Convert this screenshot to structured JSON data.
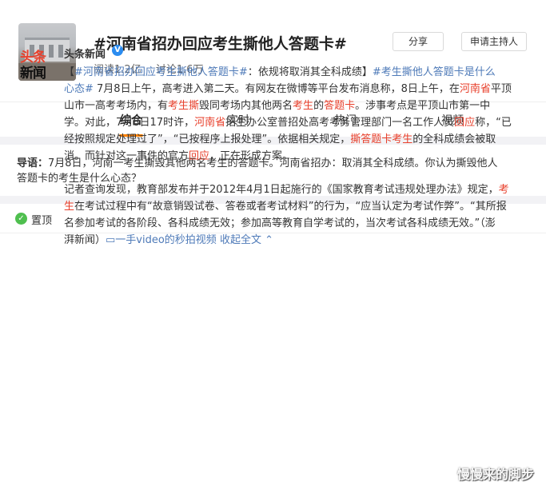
{
  "topic": {
    "title": "#河南省招办回应考生撕他人答题卡#",
    "reads": "阅读1.2亿",
    "discussions": "讨论1.6万",
    "share_label": "分享",
    "host_label": "申请主持人"
  },
  "tabs": [
    {
      "label": "综合",
      "active": true
    },
    {
      "label": "实时",
      "active": false
    },
    {
      "label": "热门",
      "active": false
    },
    {
      "label": "视频",
      "active": false
    }
  ],
  "intro": {
    "prefix": "导语：",
    "line1": "7月8日，河南一考生撕毁其他两名考生的答题卡。河南省招办：取消其全科成绩。你认为撕毁他人",
    "line2": "答题卡的考生是什么心态？"
  },
  "pinned": {
    "label": "置顶"
  },
  "post": {
    "avatar_line1_red": "头条",
    "avatar_line2": "新闻",
    "author": "头条新闻",
    "verified": "V",
    "lines": [
      [
        {
          "t": "【",
          "c": "n"
        },
        {
          "t": "#河南省招办回应考生撕他人答题卡#",
          "c": "lk"
        },
        {
          "t": "：依规将取消其全科成绩】",
          "c": "n"
        },
        {
          "t": "#考生撕他人答题卡是什么",
          "c": "lk"
        }
      ],
      [
        {
          "t": "心态#",
          "c": "lk"
        },
        {
          "t": " 7月8日上午，高考进入第二天。有网友在微博等平台发布消息称，8日上午，在",
          "c": "n"
        },
        {
          "t": "河南省",
          "c": "hl"
        },
        {
          "t": "平顶",
          "c": "n"
        }
      ],
      [
        {
          "t": "山市一高考考场内，有",
          "c": "n"
        },
        {
          "t": "考生撕",
          "c": "hl"
        },
        {
          "t": "毁同考场内其他两名",
          "c": "n"
        },
        {
          "t": "考生",
          "c": "hl"
        },
        {
          "t": "的",
          "c": "n"
        },
        {
          "t": "答题卡",
          "c": "hl"
        },
        {
          "t": "。涉事考点是平顶山市第一中",
          "c": "n"
        }
      ],
      [
        {
          "t": "学。对此，7月8日17时许，",
          "c": "n"
        },
        {
          "t": "河南省",
          "c": "hl"
        },
        {
          "t": "招生办公室普招处高考考务管理部门一名工作人员",
          "c": "n"
        },
        {
          "t": "回应",
          "c": "hl"
        },
        {
          "t": "称，“已",
          "c": "n"
        }
      ],
      [
        {
          "t": "经按照规定处理过了”，“已按程序上报处理”。依据相关规定，",
          "c": "n"
        },
        {
          "t": "撕答题卡考生",
          "c": "hl"
        },
        {
          "t": "的全科成绩会被取",
          "c": "n"
        }
      ],
      [
        {
          "t": "消。而针对这一事件的官方",
          "c": "n"
        },
        {
          "t": "回应",
          "c": "hl"
        },
        {
          "t": "，正在形成方案。",
          "c": "n"
        }
      ],
      [],
      [
        {
          "t": "记者查询发现，教育部发布并于2012年4月1日起施行的《国家教育考试违规处理办法》规定，",
          "c": "n"
        },
        {
          "t": "考",
          "c": "hl"
        }
      ],
      [
        {
          "t": "生",
          "c": "hl"
        },
        {
          "t": "在考试过程中有“故意销毁试卷、答卷或者考试材料”的行为，“应当认定为考试作弊”。“其所报",
          "c": "n"
        }
      ],
      [
        {
          "t": "名参加考试的各阶段、各科成绩无效；参加高等教育自学考试的，当次考试各科成绩无效。”（澎",
          "c": "n"
        }
      ],
      [
        {
          "t": "湃新闻）",
          "c": "n"
        },
        {
          "t": "▭一手video的秒拍视频",
          "c": "lk"
        },
        {
          "t": " 收起全文 ⌃",
          "c": "lk"
        }
      ]
    ]
  },
  "watermark": "慢慢来的脚步",
  "colors": {
    "accent": "#ff8200",
    "highlight": "#e8402c",
    "link": "#4e7ab8",
    "verified": "#2b8cf0",
    "pin": "#4fbf4f"
  }
}
